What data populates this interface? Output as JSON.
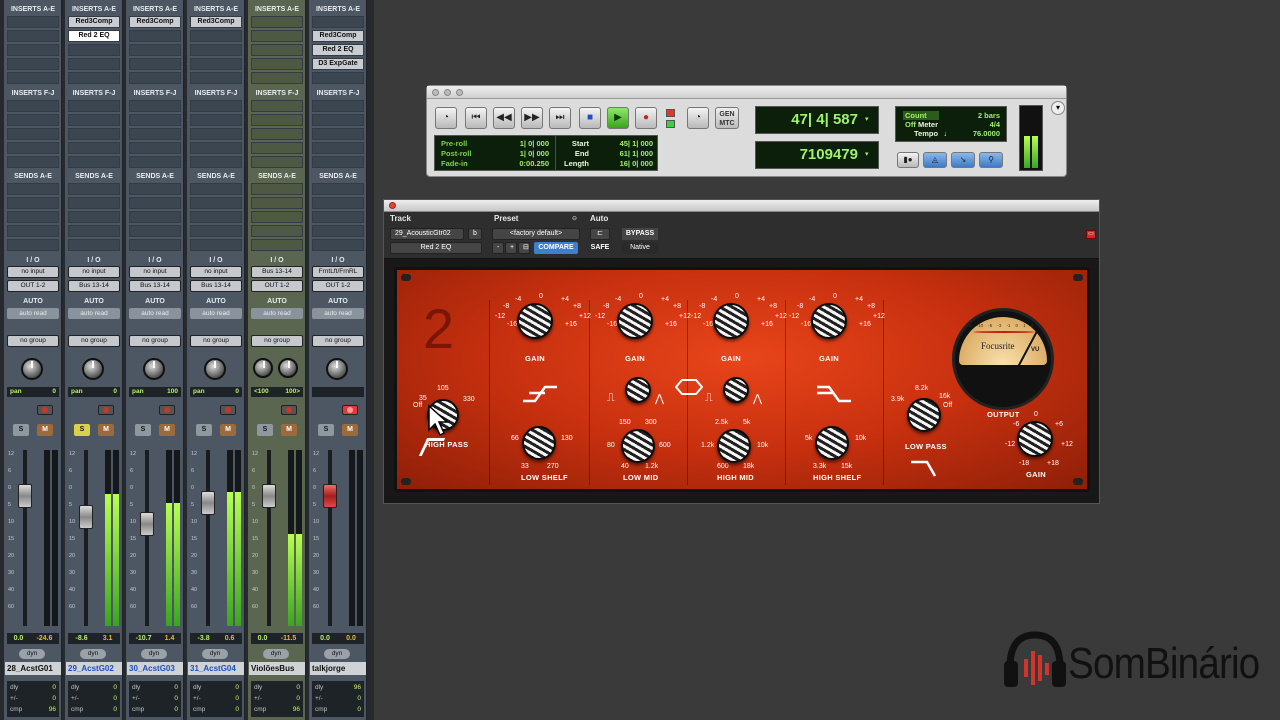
{
  "mixer": {
    "strips": [
      {
        "inserts_ae": [
          "",
          "",
          "",
          "",
          ""
        ],
        "io_in": "no input",
        "io_out": "OUT 1-2",
        "auto": "auto read",
        "group": "no group",
        "pan_label": "pan",
        "pan_val": "0",
        "vol": "0.0",
        "peak": "-24.6",
        "name": "28_AcstG01",
        "dly": "0",
        "plusminus": "0",
        "cmp": "96",
        "selected": false,
        "solo_lit": false,
        "rec_lit": false,
        "green": false,
        "fader_pct": 0.26,
        "meter_pct": 0.0
      },
      {
        "inserts_ae": [
          "Red3Comp",
          "Red 2 EQ",
          "",
          "",
          ""
        ],
        "io_in": "no input",
        "io_out": "Bus 13-14",
        "auto": "auto read",
        "group": "no group",
        "pan_label": "pan",
        "pan_val": "0",
        "vol": "-8.6",
        "peak": "3.1",
        "name": "29_AcstG02",
        "dly": "0",
        "plusminus": "0",
        "cmp": "0",
        "selected": true,
        "solo_lit": true,
        "rec_lit": false,
        "green": false,
        "fader_pct": 0.38,
        "meter_pct": 0.75
      },
      {
        "inserts_ae": [
          "Red3Comp",
          "",
          "",
          "",
          ""
        ],
        "io_in": "no input",
        "io_out": "Bus 13-14",
        "auto": "auto read",
        "group": "no group",
        "pan_label": "pan",
        "pan_val": "100",
        "vol": "-10.7",
        "peak": "1.4",
        "name": "30_AcstG03",
        "dly": "0",
        "plusminus": "0",
        "cmp": "0",
        "selected": true,
        "solo_lit": false,
        "rec_lit": false,
        "green": false,
        "fader_pct": 0.42,
        "meter_pct": 0.7
      },
      {
        "inserts_ae": [
          "Red3Comp",
          "",
          "",
          "",
          ""
        ],
        "io_in": "no input",
        "io_out": "Bus 13-14",
        "auto": "auto read",
        "group": "no group",
        "pan_label": "pan",
        "pan_val": "0",
        "vol": "-3.8",
        "peak": "0.6",
        "name": "31_AcstG04",
        "dly": "0",
        "plusminus": "0",
        "cmp": "0",
        "selected": true,
        "solo_lit": false,
        "rec_lit": false,
        "green": false,
        "fader_pct": 0.3,
        "meter_pct": 0.76
      },
      {
        "inserts_ae": [
          "",
          "",
          "",
          "",
          ""
        ],
        "io_in": "Bus 13-14",
        "io_out": "OUT 1-2",
        "auto": "auto read",
        "group": "no group",
        "pan_label": "<100",
        "pan_val": "100>",
        "vol": "0.0",
        "peak": "-11.5",
        "name": "ViolõesBus",
        "dly": "0",
        "plusminus": "0",
        "cmp": "96",
        "selected": false,
        "solo_lit": false,
        "rec_lit": false,
        "green": true,
        "fader_pct": 0.26,
        "meter_pct": 0.52
      },
      {
        "inserts_ae": [
          "",
          "Red3Comp",
          "Red 2 EQ",
          "D3 ExpGate",
          ""
        ],
        "io_in": "FrntLft/FrnRL",
        "io_out": "OUT 1-2",
        "auto": "auto read",
        "group": "no group",
        "pan_label": "",
        "pan_val": "",
        "vol": "0.0",
        "peak": "0.0",
        "name": "talkjorge",
        "dly": "96",
        "plusminus": "0",
        "cmp": "0",
        "selected": false,
        "solo_lit": false,
        "rec_lit": true,
        "green": false,
        "fader_pct": 0.26,
        "meter_pct": 0.0
      }
    ],
    "labels": {
      "inserts_ae": "INSERTS A-E",
      "inserts_fj": "INSERTS F-J",
      "sends_ae": "SENDS A-E",
      "io": "I / O",
      "auto": "AUTO",
      "dyn": "dyn",
      "dly": "dly",
      "pm": "+/-",
      "cmp": "cmp",
      "s": "S",
      "m": "M"
    },
    "scale": [
      "12",
      "6",
      "0",
      "5",
      "10",
      "15",
      "20",
      "30",
      "40",
      "60"
    ]
  },
  "transport": {
    "counter_main": "47| 4| 587",
    "counter_sub": "7109479",
    "preroll_label": "Pre-roll",
    "preroll": "1| 0| 000",
    "postroll_label": "Post-roll",
    "postroll": "1| 0| 000",
    "fadein_label": "Fade-in",
    "fadein": "0:00.250",
    "start_label": "Start",
    "start": "45| 1| 000",
    "end_label": "End",
    "end": "61| 1| 000",
    "length_label": "Length",
    "length": "16| 0| 000",
    "countoff": "Count Off",
    "countoff_val": "2 bars",
    "meter_label": "Meter",
    "meter_val": "4/4",
    "tempo_label": "Tempo",
    "tempo_val": "76.0000",
    "gen_label": "GEN MTC"
  },
  "plugin": {
    "track_label": "Track",
    "preset_label": "Preset",
    "auto_label": "Auto",
    "track_name": "29_AcousticGtr02",
    "track_b": "b",
    "preset_name": "<factory default>",
    "plugin_name": "Red 2 EQ",
    "compare": "COMPARE",
    "safe": "SAFE",
    "bypass": "BYPASS",
    "native": "Native",
    "model_numeral": "2",
    "brand": "Focusrite",
    "vu_label": "VU",
    "bands": {
      "hp_vals": [
        "105",
        "330",
        "Off",
        "35"
      ],
      "hp_title": "HIGH PASS",
      "gain_title": "GAIN",
      "gain_scale": [
        "-4",
        "0",
        "+4",
        "-8",
        "+8",
        "-12",
        "+12",
        "-16",
        "+16"
      ],
      "low_shelf": {
        "title": "LOW SHELF",
        "vals": [
          "66",
          "130",
          "33",
          "270"
        ]
      },
      "low_mid": {
        "title": "LOW MID",
        "vals": [
          "150",
          "300",
          "80",
          "600",
          "40",
          "1.2k"
        ]
      },
      "high_mid": {
        "title": "HIGH MID",
        "vals": [
          "2.5k",
          "5k",
          "1.2k",
          "10k",
          "600",
          "18k"
        ]
      },
      "high_shelf": {
        "title": "HIGH SHELF",
        "vals": [
          "5k",
          "10k",
          "3.3k",
          "15k"
        ]
      },
      "low_pass": {
        "title": "LOW PASS",
        "vals": [
          "8.2k",
          "3.9k",
          "16k",
          "Off"
        ]
      },
      "output": {
        "title": "OUTPUT",
        "gain_title": "GAIN",
        "vals": [
          "0",
          "-6",
          "+6",
          "-12",
          "+12",
          "-18",
          "+18"
        ]
      },
      "vu_scale": [
        "-20",
        "-10",
        "-5",
        "-3",
        "-1",
        "0",
        "1",
        "2",
        "3"
      ]
    }
  },
  "logo": {
    "text": "SomBinário",
    "color": "#d1342a"
  },
  "colors": {
    "accent_red": "#d1342a",
    "lcd_green": "#9ff26a",
    "play_green": "#3aa31c"
  }
}
